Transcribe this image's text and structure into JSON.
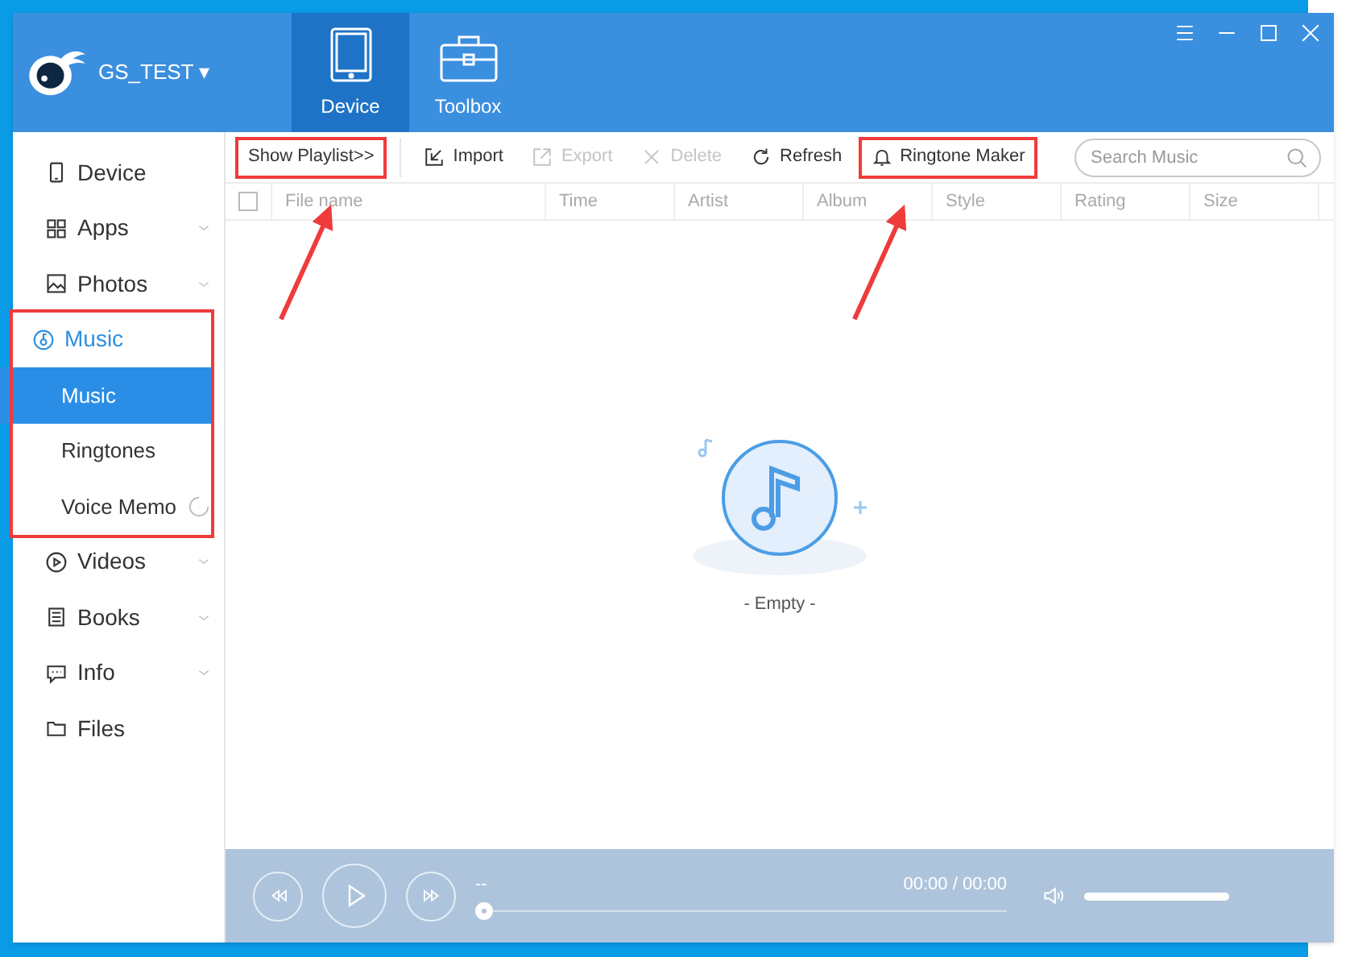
{
  "header": {
    "account": "GS_TEST",
    "caret": "▾",
    "tabs": [
      {
        "label": "Device",
        "kind": "device",
        "selected": true
      },
      {
        "label": "Toolbox",
        "kind": "toolbox",
        "selected": false
      }
    ]
  },
  "sidebar": {
    "items": [
      {
        "label": "Device",
        "kind": "device",
        "expandable": false,
        "expanded": false,
        "highlighted": false
      },
      {
        "label": "Apps",
        "kind": "apps",
        "expandable": true,
        "expanded": false,
        "highlighted": false
      },
      {
        "label": "Photos",
        "kind": "photos",
        "expandable": true,
        "expanded": false,
        "highlighted": false
      },
      {
        "label": "Music",
        "kind": "music",
        "expandable": true,
        "expanded": true,
        "highlighted": true,
        "children": [
          {
            "label": "Music",
            "selected": true,
            "loading": false
          },
          {
            "label": "Ringtones",
            "selected": false,
            "loading": false
          },
          {
            "label": "Voice Memo",
            "selected": false,
            "loading": true
          }
        ]
      },
      {
        "label": "Videos",
        "kind": "videos",
        "expandable": true,
        "expanded": false,
        "highlighted": false
      },
      {
        "label": "Books",
        "kind": "books",
        "expandable": true,
        "expanded": false,
        "highlighted": false
      },
      {
        "label": "Info",
        "kind": "info",
        "expandable": true,
        "expanded": false,
        "highlighted": false
      },
      {
        "label": "Files",
        "kind": "files",
        "expandable": false,
        "expanded": false,
        "highlighted": false
      }
    ]
  },
  "toolbar": {
    "items": [
      {
        "label": "Show Playlist>>",
        "kind": "text",
        "disabled": false,
        "highlighted": true
      },
      {
        "label": "Import",
        "kind": "import",
        "disabled": false,
        "highlighted": false
      },
      {
        "label": "Export",
        "kind": "export",
        "disabled": true,
        "highlighted": false
      },
      {
        "label": "Delete",
        "kind": "delete",
        "disabled": true,
        "highlighted": false
      },
      {
        "label": "Refresh",
        "kind": "refresh",
        "disabled": false,
        "highlighted": false
      },
      {
        "label": "Ringtone Maker",
        "kind": "bell",
        "disabled": false,
        "highlighted": true
      }
    ],
    "search": {
      "placeholder": "Search Music"
    }
  },
  "table": {
    "columns": [
      "File name",
      "Time",
      "Artist",
      "Album",
      "Style",
      "Rating",
      "Size"
    ],
    "select_all": {
      "checked": false
    }
  },
  "empty_state": {
    "text": "- Empty -"
  },
  "player": {
    "track": "--",
    "time": "00:00 / 00:00",
    "progress": {
      "level": 0
    },
    "volume": {
      "level": 1
    }
  }
}
